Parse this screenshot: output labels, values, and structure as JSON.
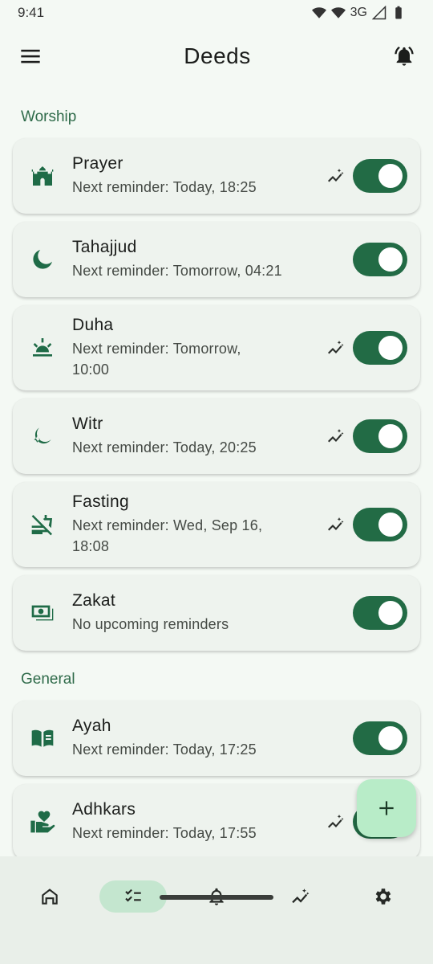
{
  "status_bar": {
    "time": "9:41",
    "network": "3G"
  },
  "app_bar": {
    "title": "Deeds"
  },
  "sections": [
    {
      "title": "Worship",
      "items": [
        {
          "name": "Prayer",
          "sub": "Next reminder: Today, 18:25",
          "icon": "mosque-icon",
          "trend": true,
          "enabled": true
        },
        {
          "name": "Tahajjud",
          "sub": "Next reminder: Tomorrow, 04:21",
          "icon": "moon-icon",
          "trend": false,
          "enabled": true
        },
        {
          "name": "Duha",
          "sub": "Next reminder: Tomorrow, 10:00",
          "icon": "sunrise-icon",
          "trend": true,
          "enabled": true
        },
        {
          "name": "Witr",
          "sub": "Next reminder: Today, 20:25",
          "icon": "moon-star-icon",
          "trend": true,
          "enabled": true
        },
        {
          "name": "Fasting",
          "sub": "Next reminder: Wed, Sep 16, 18:08",
          "icon": "no-food-icon",
          "trend": true,
          "enabled": true
        },
        {
          "name": "Zakat",
          "sub": "No upcoming reminders",
          "icon": "money-icon",
          "trend": false,
          "enabled": true
        }
      ]
    },
    {
      "title": "General",
      "items": [
        {
          "name": "Ayah",
          "sub": "Next reminder: Today, 17:25",
          "icon": "book-icon",
          "trend": false,
          "enabled": true
        },
        {
          "name": "Adhkars",
          "sub": "Next reminder: Today, 17:55",
          "icon": "hand-heart-icon",
          "trend": true,
          "enabled": true
        }
      ]
    }
  ],
  "bottom_nav": [
    "home",
    "deeds",
    "reminders",
    "stats",
    "settings"
  ],
  "active_tab": "deeds",
  "colors": {
    "accent": "#226b45",
    "fab": "#b8ecc8",
    "background": "#f4f9f4",
    "card": "#eef3ee"
  }
}
